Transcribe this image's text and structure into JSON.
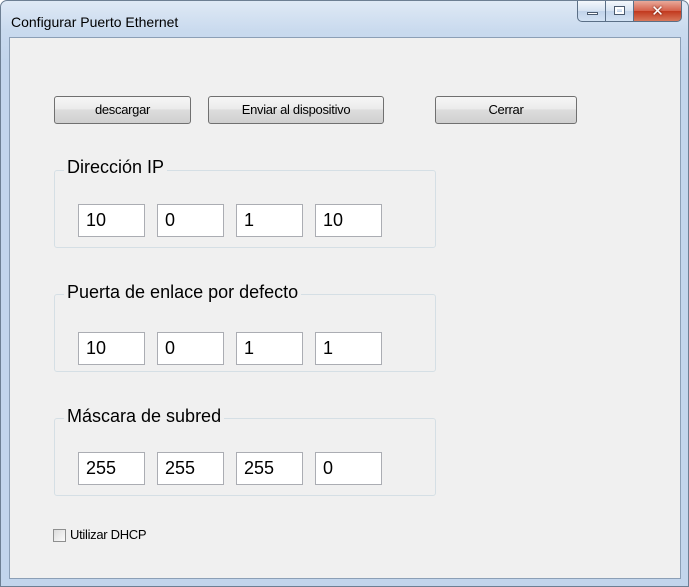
{
  "window": {
    "title": "Configurar Puerto Ethernet"
  },
  "toolbar": {
    "download_label": "descargar",
    "send_label": "Enviar al dispositivo",
    "close_label": "Cerrar"
  },
  "ip_group": {
    "legend": "Dirección IP",
    "octets": [
      "10",
      "0",
      "1",
      "10"
    ]
  },
  "gateway_group": {
    "legend": "Puerta de enlace por defecto",
    "octets": [
      "10",
      "0",
      "1",
      "1"
    ]
  },
  "subnet_group": {
    "legend": "Máscara de subred",
    "octets": [
      "255",
      "255",
      "255",
      "0"
    ]
  },
  "dhcp": {
    "label": "Utilizar DHCP",
    "checked": false
  }
}
